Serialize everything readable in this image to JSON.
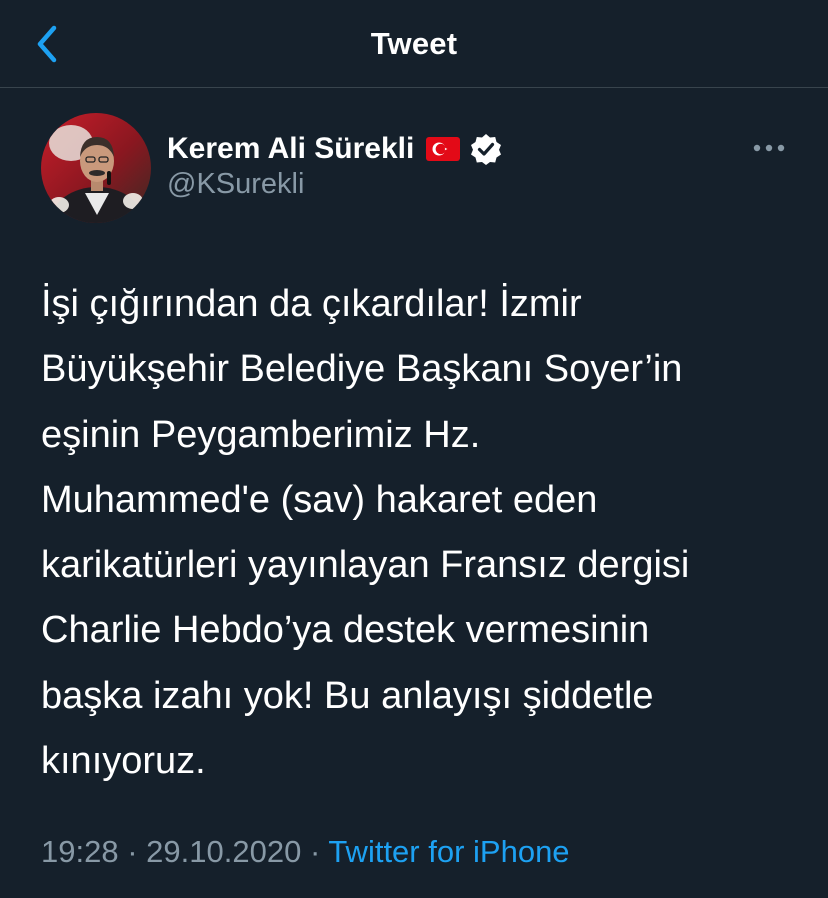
{
  "header": {
    "title": "Tweet",
    "back_icon": "chevron-left-icon"
  },
  "author": {
    "name": "Kerem Ali Sürekli",
    "handle": "@KSurekli",
    "flag_icon": "turkey-flag-icon",
    "verified_icon": "verified-badge-icon"
  },
  "tweet": {
    "lines": [
      "İşi çığırından da çıkardılar! İzmir",
      "Büyükşehir Belediye Başkanı  Soyer’in",
      "eşinin Peygamberimiz Hz.",
      "Muhammed'e (sav) hakaret eden",
      "karikatürleri yayınlayan Fransız dergisi",
      "Charlie Hebdo’ya destek vermesinin",
      "başka izahı yok! Bu anlayışı şiddetle",
      "kınıyoruz."
    ]
  },
  "meta": {
    "time": "19:28",
    "separator": "·",
    "date": "29.10.2020",
    "source": "Twitter for iPhone"
  },
  "colors": {
    "background": "#15202b",
    "text": "#ffffff",
    "secondary": "#8899a6",
    "accent": "#1da1f2",
    "divider": "#38444d"
  }
}
